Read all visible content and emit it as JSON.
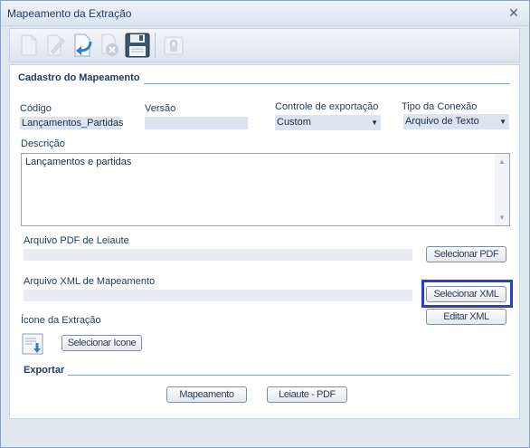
{
  "window": {
    "title": "Mapeamento da Extração",
    "close_glyph": "✕"
  },
  "toolbar": {
    "buttons": [
      {
        "name": "new-document-icon",
        "enabled": false
      },
      {
        "name": "edit-pencil-icon",
        "enabled": false
      },
      {
        "name": "undo-arrow-icon",
        "enabled": true
      },
      {
        "name": "delete-icon",
        "enabled": false
      },
      {
        "name": "save-floppy-icon",
        "enabled": true
      },
      {
        "name": "lock-icon",
        "enabled": false
      }
    ]
  },
  "cadastro": {
    "section_title": "Cadastro do Mapeamento",
    "codigo_label": "Código",
    "codigo_value": "Lançamentos_Partidas",
    "versao_label": "Versão",
    "versao_value": "",
    "controle_label": "Controle de exportação",
    "controle_value": "Custom",
    "tipo_label": "Tipo da Conexão",
    "tipo_value": "Arquivo de Texto",
    "descricao_label": "Descrição",
    "descricao_value": "Lançamentos e partidas",
    "pdf_label": "Arquivo PDF de Leiaute",
    "pdf_button": "Selecionar PDF",
    "xml_label": "Arquivo XML de Mapeamento",
    "xml_button": "Selecionar XML",
    "editar_xml_button": "Editar XML",
    "icone_label": "Ícone da Extração",
    "icone_button": "Selecionar Icone"
  },
  "exportar": {
    "section_title": "Exportar",
    "mapeamento_button": "Mapeamento",
    "leiaute_button": "Leiaute - PDF"
  },
  "colors": {
    "highlight": "#2b3fbf",
    "field_bg": "#dbe4ef",
    "text": "#1e3a5c"
  }
}
